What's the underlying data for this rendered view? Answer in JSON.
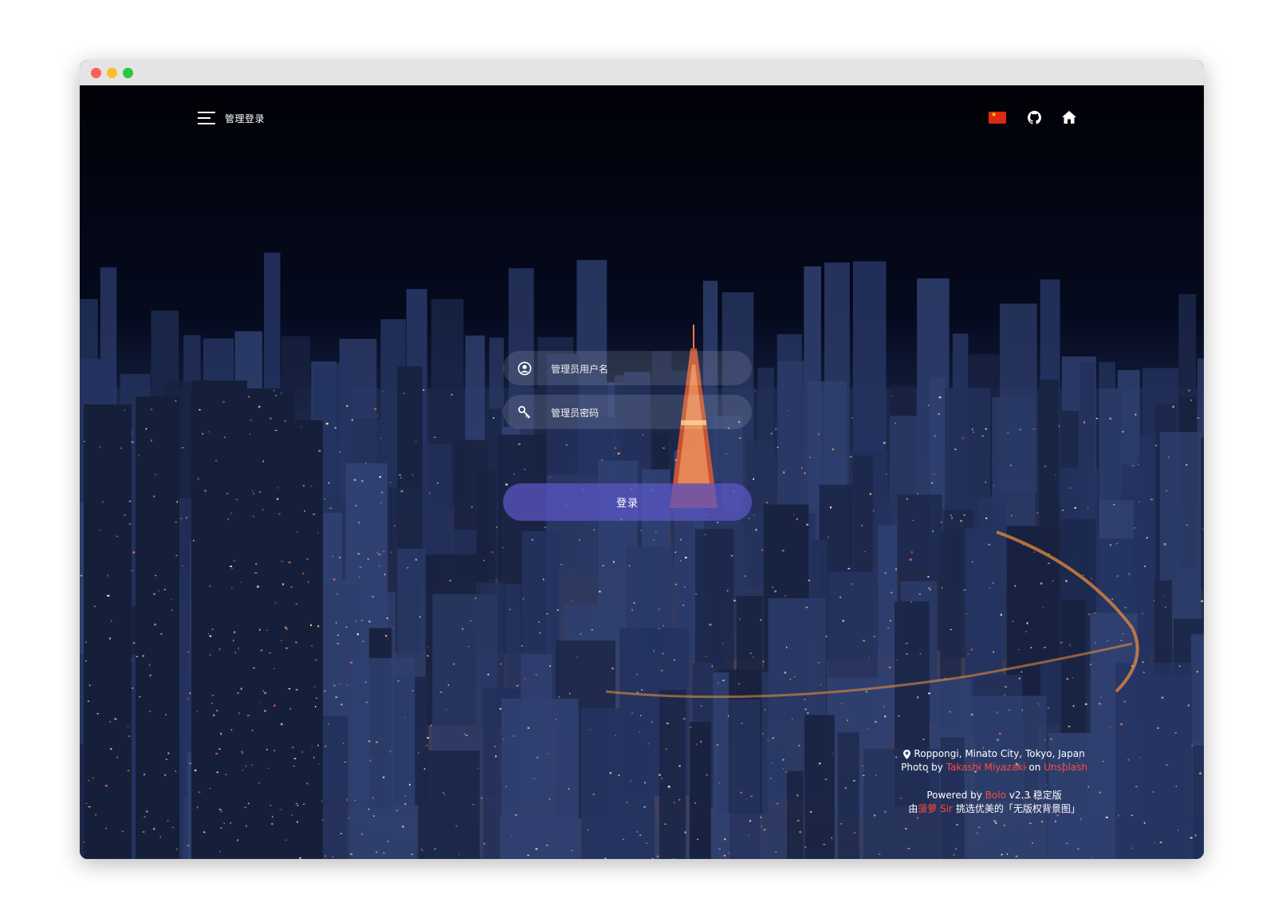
{
  "window": {
    "dots": [
      "close",
      "minimize",
      "maximize"
    ]
  },
  "nav": {
    "title": "管理登录",
    "icons": [
      "menu-icon",
      "china-flag-icon",
      "github-icon",
      "home-icon"
    ]
  },
  "login": {
    "username_placeholder": "管理员用户名",
    "password_placeholder": "管理员密码",
    "button_label": "登录"
  },
  "credits": {
    "location": "Roppongi, Minato City, Tokyo, Japan",
    "photo_prefix": "Photo by",
    "photographer": "Takashi Miyazaki",
    "on": "on",
    "source": "Unsplash",
    "powered_prefix": "Powered by",
    "powered_brand": "Bolo",
    "powered_suffix": "v2.3 稳定版",
    "by_prefix": "由",
    "by_name": "菠萝 Sir",
    "by_suffix": "挑选优美的「无版权背景图」"
  },
  "colors": {
    "accent_red": "#ff4a3d",
    "button": "#5c58c8",
    "sky": "#040612"
  }
}
